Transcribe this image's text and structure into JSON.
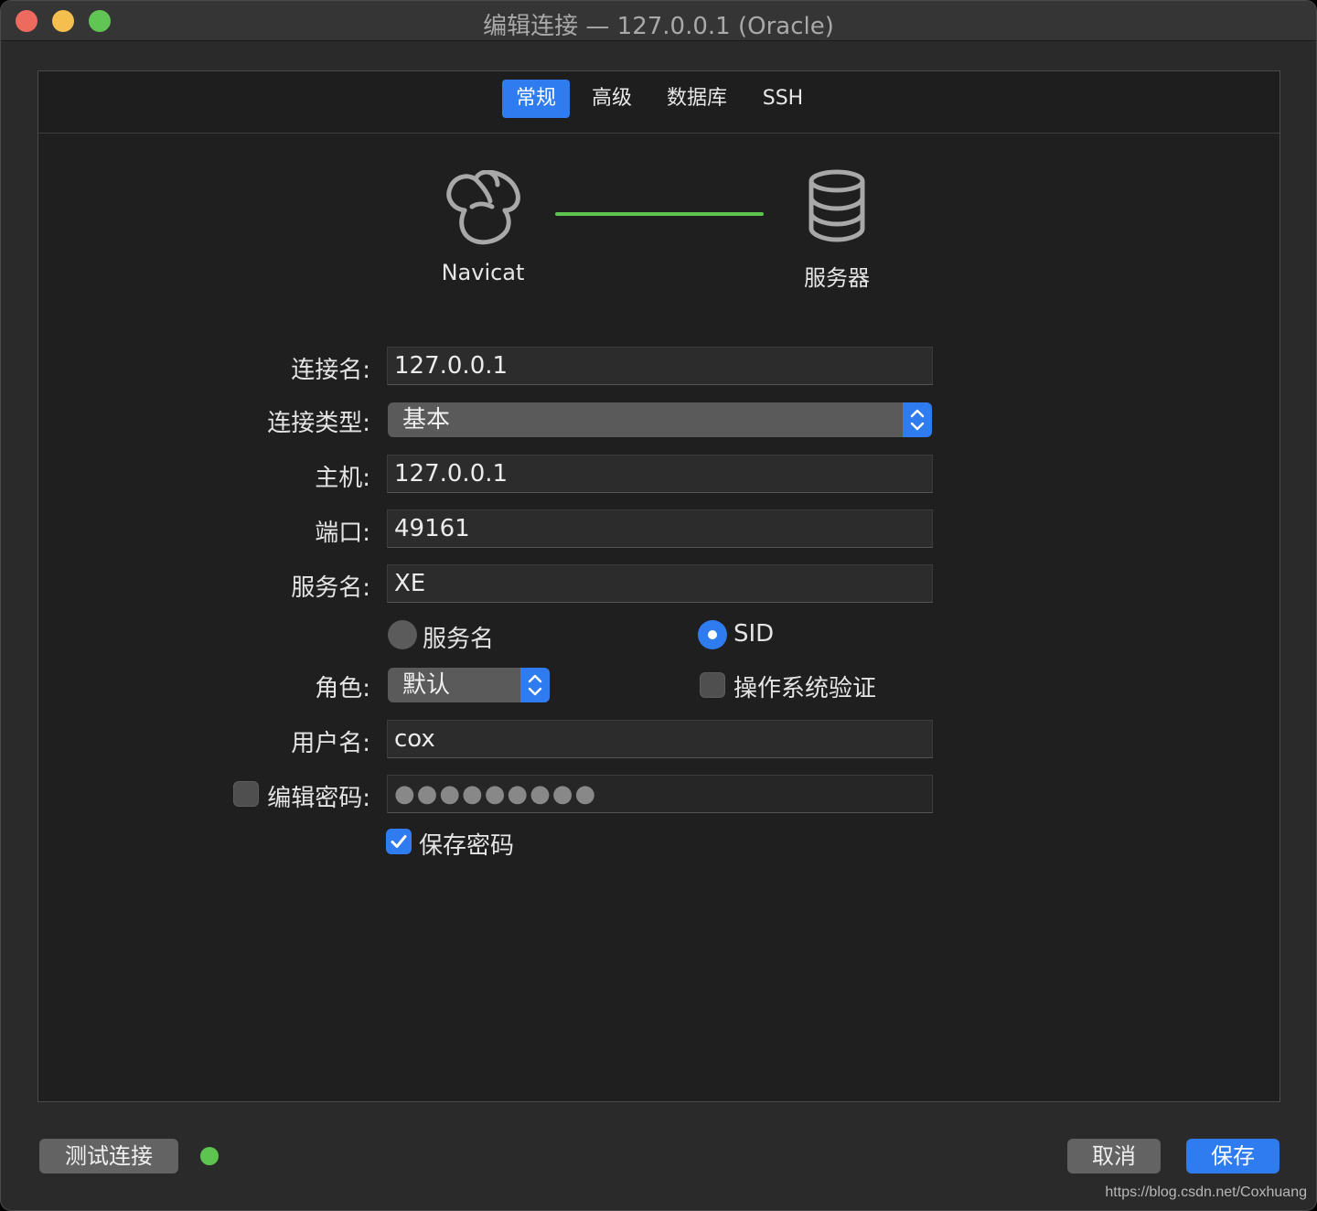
{
  "window": {
    "title": "编辑连接 — 127.0.0.1 (Oracle)"
  },
  "tabs": [
    {
      "label": "常规",
      "active": true
    },
    {
      "label": "高级",
      "active": false
    },
    {
      "label": "数据库",
      "active": false
    },
    {
      "label": "SSH",
      "active": false
    }
  ],
  "diagram": {
    "client_label": "Navicat",
    "server_label": "服务器",
    "client_icon": "navicat-logo-icon",
    "server_icon": "database-icon",
    "link_color": "#5cc44f"
  },
  "form": {
    "connection_name": {
      "label": "连接名:",
      "value": "127.0.0.1"
    },
    "connection_type": {
      "label": "连接类型:",
      "value": "基本"
    },
    "host": {
      "label": "主机:",
      "value": "127.0.0.1"
    },
    "port": {
      "label": "端口:",
      "value": "49161"
    },
    "service_name": {
      "label": "服务名:",
      "value": "XE"
    },
    "service_mode": {
      "option_service_name": "服务名",
      "option_sid": "SID",
      "selected": "SID"
    },
    "role": {
      "label": "角色:",
      "value": "默认"
    },
    "os_auth": {
      "label": "操作系统验证",
      "checked": false
    },
    "username": {
      "label": "用户名:",
      "value": "cox"
    },
    "edit_password": {
      "label": "编辑密码:",
      "checked": false,
      "placeholder": "●●●●●●●●●"
    },
    "save_password": {
      "label": "保存密码",
      "checked": true
    }
  },
  "footer": {
    "test_button": "测试连接",
    "cancel_button": "取消",
    "save_button": "保存",
    "status_color": "#5cc44f",
    "watermark": "https://blog.csdn.net/Coxhuang"
  },
  "colors": {
    "accent": "#2f7bf0",
    "success": "#5cc44f"
  }
}
